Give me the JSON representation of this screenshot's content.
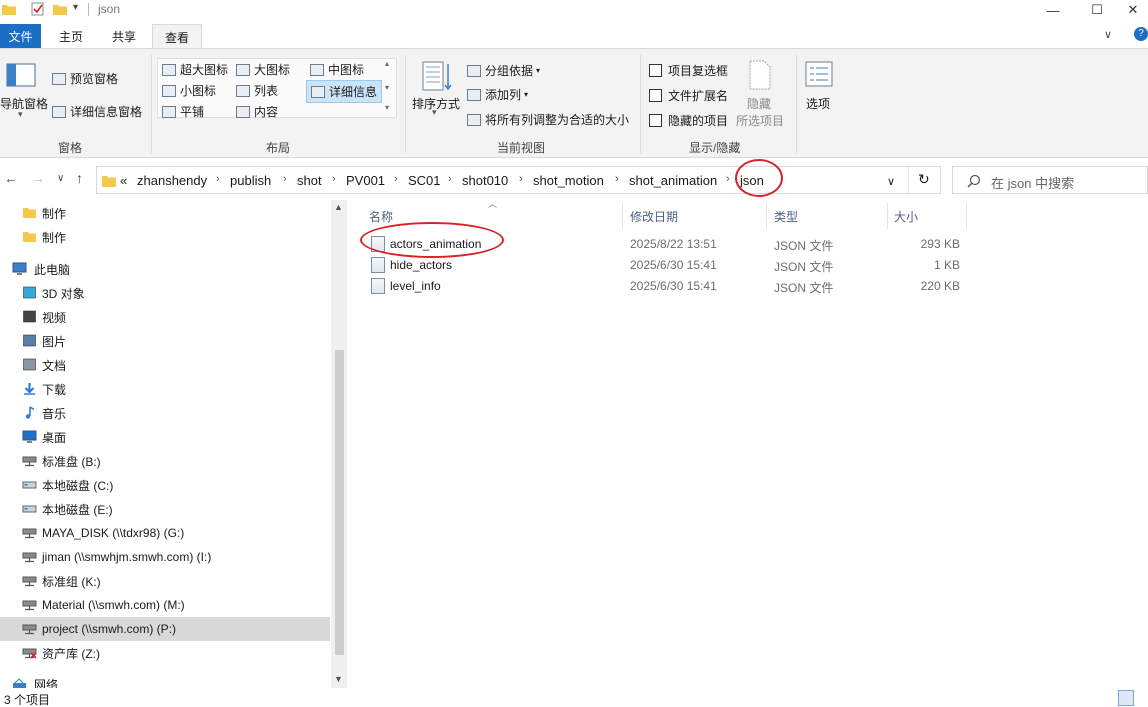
{
  "window": {
    "title": "json",
    "minimize": "—",
    "maximize": "☐",
    "close": "✕"
  },
  "ribbon_tabs": {
    "file": "文件",
    "home": "主页",
    "share": "共享",
    "view": "查看",
    "collapse": "∨",
    "help": "?"
  },
  "ribbon": {
    "panes": {
      "nav_pane": "导航窗格",
      "preview_pane": "预览窗格",
      "details_pane": "详细信息窗格",
      "group_label": "窗格"
    },
    "layout": {
      "extra_large": "超大图标",
      "large": "大图标",
      "medium": "中图标",
      "small": "小图标",
      "list": "列表",
      "details": "详细信息",
      "tiles": "平铺",
      "content": "内容",
      "group_label": "布局"
    },
    "current_view": {
      "sort_by": "排序方式",
      "group_by": "分组依据",
      "add_column": "添加列",
      "fit_columns": "将所有列调整为合适的大小",
      "group_label": "当前视图"
    },
    "show_hide": {
      "item_checkboxes": "项目复选框",
      "file_extensions": "文件扩展名",
      "hidden_items": "隐藏的项目",
      "hide_selected_1": "隐藏",
      "hide_selected_2": "所选项目",
      "group_label": "显示/隐藏"
    },
    "options": {
      "label": "选项"
    }
  },
  "address": {
    "overflow": "«",
    "crumbs": [
      "zhanshendy",
      "publish",
      "shot",
      "PV001",
      "SC01",
      "shot010",
      "shot_motion",
      "shot_animation",
      "json"
    ],
    "separator": "›",
    "dropdown": "∨",
    "refresh": "↻"
  },
  "nav_buttons": {
    "back": "←",
    "forward": "→",
    "recent": "∨",
    "up": "↑"
  },
  "search": {
    "placeholder": "在 json 中搜索"
  },
  "nav_pane": {
    "items": [
      {
        "label": "制作",
        "icon": "folder-icon"
      },
      {
        "label": "制作",
        "icon": "folder-icon"
      },
      {
        "label": "此电脑",
        "icon": "computer-icon"
      },
      {
        "label": "3D 对象",
        "icon": "3d-objects-icon"
      },
      {
        "label": "视频",
        "icon": "video-icon"
      },
      {
        "label": "图片",
        "icon": "pictures-icon"
      },
      {
        "label": "文档",
        "icon": "documents-icon"
      },
      {
        "label": "下载",
        "icon": "download-icon"
      },
      {
        "label": "音乐",
        "icon": "music-icon"
      },
      {
        "label": "桌面",
        "icon": "desktop-icon"
      },
      {
        "label": "标准盘 (B:)",
        "icon": "network-drive-icon"
      },
      {
        "label": "本地磁盘 (C:)",
        "icon": "local-disk-icon"
      },
      {
        "label": "本地磁盘 (E:)",
        "icon": "local-disk-icon"
      },
      {
        "label": "MAYA_DISK (\\\\tdxr98) (G:)",
        "icon": "network-drive-icon"
      },
      {
        "label": "jiman (\\\\smwhjm.smwh.com) (I:)",
        "icon": "network-drive-icon"
      },
      {
        "label": "标准组 (K:)",
        "icon": "network-drive-icon"
      },
      {
        "label": "Material (\\\\smwh.com) (M:)",
        "icon": "network-drive-icon"
      },
      {
        "label": "project (\\\\smwh.com) (P:)",
        "icon": "network-drive-icon"
      },
      {
        "label": "资产库 (Z:)",
        "icon": "disconnected-drive-icon"
      },
      {
        "label": "网络",
        "icon": "network-icon"
      }
    ]
  },
  "file_list": {
    "columns": {
      "name": "名称",
      "date": "修改日期",
      "type": "类型",
      "size": "大小"
    },
    "rows": [
      {
        "name": "actors_animation",
        "date": "2025/8/22 13:51",
        "type": "JSON 文件",
        "size": "293 KB"
      },
      {
        "name": "hide_actors",
        "date": "2025/6/30 15:41",
        "type": "JSON 文件",
        "size": "1 KB"
      },
      {
        "name": "level_info",
        "date": "2025/6/30 15:41",
        "type": "JSON 文件",
        "size": "220 KB"
      }
    ]
  },
  "status_bar": {
    "count": "3 个项目"
  },
  "colors": {
    "accent": "#1a6fc4",
    "annotation_red": "#d9232b",
    "selected_nav": "#d9d9d9"
  }
}
